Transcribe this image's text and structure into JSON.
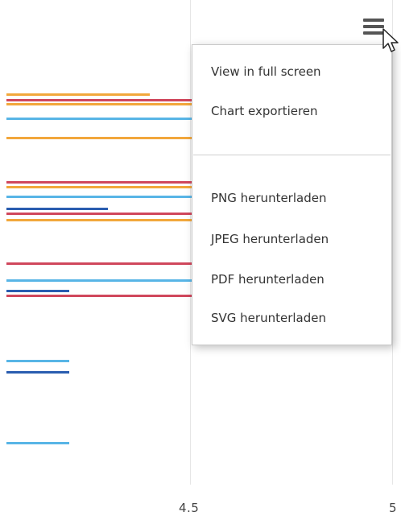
{
  "chart": {
    "x_tick_labels": [
      "4.5",
      "5"
    ],
    "colors": {
      "orange": "#f2a73b",
      "red": "#d0475c",
      "lightblue": "#58b5e6",
      "darkblue": "#2a5db0",
      "grid": "#e6e6e6"
    }
  },
  "chart_data": {
    "type": "bar",
    "orientation": "horizontal",
    "visible_x_ticks": [
      4.5,
      5
    ],
    "bars": [
      {
        "color": "orange",
        "value_visible": "partial"
      },
      {
        "color": "red",
        "value_visible": "clipped"
      },
      {
        "color": "orange",
        "value_visible": "clipped"
      },
      {
        "color": "lightblue",
        "value_visible": "clipped"
      },
      {
        "color": "orange",
        "value_visible": "clipped"
      },
      {
        "color": "red",
        "value_visible": "clipped"
      },
      {
        "color": "orange",
        "value_visible": "clipped"
      },
      {
        "color": "lightblue",
        "value_visible": "clipped"
      },
      {
        "color": "darkblue",
        "value_visible": "partial"
      },
      {
        "color": "red",
        "value_visible": "clipped"
      },
      {
        "color": "orange",
        "value_visible": "clipped"
      },
      {
        "color": "red",
        "value_visible": "clipped"
      },
      {
        "color": "lightblue",
        "value_visible": "clipped"
      },
      {
        "color": "darkblue",
        "value_visible": "partial"
      },
      {
        "color": "red",
        "value_visible": "clipped"
      },
      {
        "color": "lightblue",
        "value_visible": "partial"
      },
      {
        "color": "darkblue",
        "value_visible": "partial"
      },
      {
        "color": "lightblue",
        "value_visible": "partial"
      }
    ]
  },
  "menu": {
    "button_icon": "hamburger-menu-icon",
    "cursor_icon": "mouse-pointer-icon",
    "items_top": [
      "View in full screen",
      "Chart exportieren"
    ],
    "items_bottom": [
      "PNG herunterladen",
      "JPEG herunterladen",
      "PDF herunterladen",
      "SVG herunterladen"
    ]
  }
}
